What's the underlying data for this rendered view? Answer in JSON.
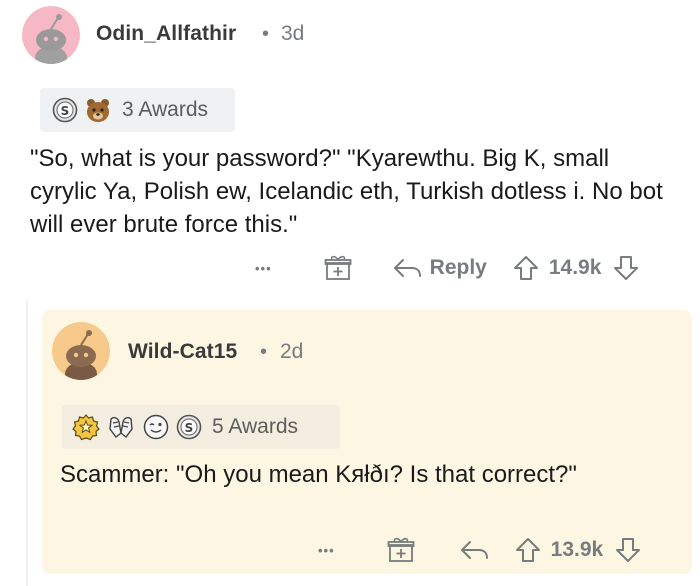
{
  "comment": {
    "username": "Odin_Allfathir",
    "separator": "•",
    "age": "3d",
    "awards_label": "3 Awards",
    "award_icons": [
      "silver-award-icon",
      "bear-award-icon"
    ],
    "text": "\"So, what is your password?\" \"Kyarewthu. Big K, small cyrylic Ya, Polish ew, Icelandic eth, Turkish dotless i. No bot will ever brute force this.\"",
    "actions": {
      "more": "•••",
      "reply_label": "Reply",
      "score": "14.9k"
    }
  },
  "reply": {
    "username": "Wild-Cat15",
    "separator": "•",
    "age": "2d",
    "awards_label": "5 Awards",
    "award_icons": [
      "star-award-icon",
      "hands-award-icon",
      "wink-award-icon",
      "silver-award-icon"
    ],
    "text": "Scammer: \"Oh you mean Kяłðı? Is that correct?\"",
    "actions": {
      "more": "•••",
      "score": "13.9k"
    }
  },
  "colors": {
    "avatar_pink": "#f5b8c4",
    "avatar_orange": "#f7c98a",
    "reply_background": "#fdf6e3",
    "meta_gray": "#787c7e"
  }
}
